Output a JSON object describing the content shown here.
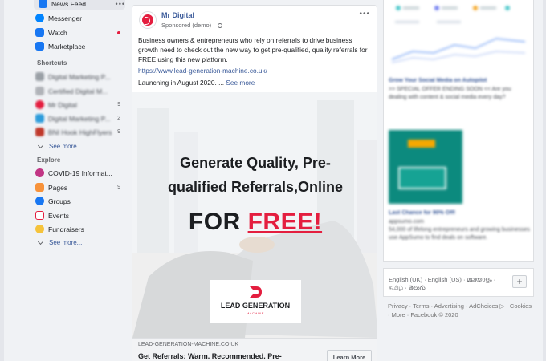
{
  "sidebar": {
    "items": [
      {
        "label": "News Feed",
        "icon": "news-feed-icon",
        "color": "#1877f2",
        "top": 0
      },
      {
        "label": "Messenger",
        "icon": "messenger-icon",
        "color": "#0084ff"
      },
      {
        "label": "Watch",
        "icon": "watch-icon",
        "color": "#1877f2"
      },
      {
        "label": "Marketplace",
        "icon": "marketplace-icon",
        "color": "#1877f2"
      }
    ],
    "shortcuts_heading": "Shortcuts",
    "shortcuts": [
      {
        "label": "Digital Marketing P...",
        "count": ""
      },
      {
        "label": "Certified Digital M...",
        "count": ""
      },
      {
        "label": "Mr Digital",
        "count": "9"
      },
      {
        "label": "Digital Marketing P...",
        "count": "2"
      },
      {
        "label": "BNI Hook HighFlyers",
        "count": "9"
      }
    ],
    "see_more_1": "See more...",
    "explore_heading": "Explore",
    "explore": [
      {
        "label": "COVID-19 Informat...",
        "count": "",
        "icon": "covid-info-icon"
      },
      {
        "label": "Pages",
        "count": "9",
        "icon": "flag-icon"
      },
      {
        "label": "Groups",
        "count": "",
        "icon": "groups-icon"
      },
      {
        "label": "Events",
        "count": "",
        "icon": "calendar-icon"
      },
      {
        "label": "Fundraisers",
        "count": "",
        "icon": "fundraiser-icon"
      }
    ],
    "see_more_2": "See more..."
  },
  "post": {
    "author": "Mr Digital",
    "sponsored": "Sponsored (demo) ·",
    "text": "Business owners & entrepreneurs who rely on referrals to drive business growth need to check out the new way to get pre-qualified, quality referrals for FREE using this new platform.",
    "link": "https://www.lead-generation-machine.co.uk/",
    "launch_text": "Launching in August 2020. ...",
    "see_more": "See more",
    "ad_line1": "Generate Quality, Pre-",
    "ad_line2": "qualified Referrals,Online",
    "ad_line3_a": "FOR ",
    "ad_line3_b": "FREE!",
    "logo_text": "LEAD GENERATION",
    "logo_sub": "MACHINE",
    "footer_domain": "LEAD-GENERATION-MACHINE.CO.UK",
    "footer_title": "Get Referrals: Warm. Recommended. Pre-Qualified.",
    "cta": "Learn More",
    "accent": "#e41e3f"
  },
  "right": {
    "ad1_title": "Grow Your Social Media on Autopilot",
    "ad1_body": ">> SPECIAL OFFER ENDING SOON << Are you dealing with content & social media every day?",
    "ad2_title": "Last Chance for 90% Off!",
    "ad2_domain": "appsumo.com",
    "ad2_body": "54,000 of lifelong entrepreneurs and growing businesses use AppSumo to find deals on software.",
    "languages": "English (UK) · English (US) · മലയാളം · தமிழ் · తెలుగు",
    "footer": "Privacy · Terms · Advertising · AdChoices ▷ · Cookies · More · Facebook © 2020"
  }
}
